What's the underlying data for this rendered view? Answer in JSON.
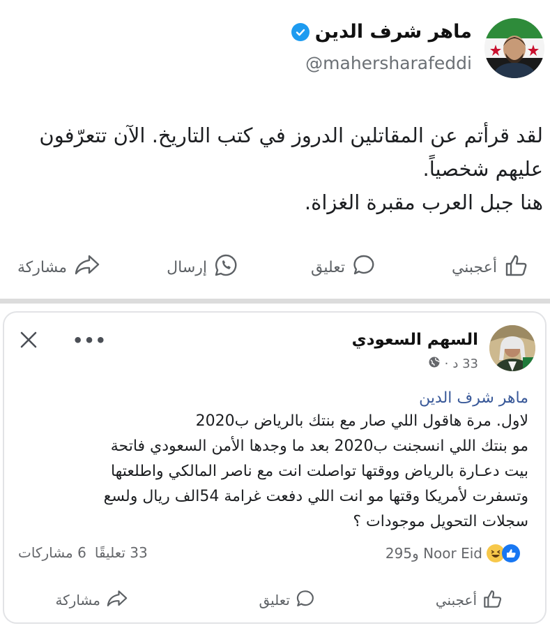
{
  "top_post": {
    "author_name": "ماهر شرف الدين",
    "handle": "@mahersharafeddi",
    "text_lines": [
      "لقد قرأتم عن المقاتلين الدروز في كتب التاريخ. الآن تتعرّفون",
      "عليهم شخصياً.",
      "هنا جبل العرب مقبرة الغزاة."
    ],
    "actions": {
      "like": "أعجبني",
      "comment": "تعليق",
      "send": "إرسال",
      "share": "مشاركة"
    }
  },
  "fb_post": {
    "author_name": "السهم السعودي",
    "time": "33 د",
    "mention": "ماهر شرف الدين",
    "text_lines": [
      "لاول. مرة هاقول اللي صار مع بنتك بالرياض ب2020",
      "مو  بنتك اللي انسجنت ب2020 بعد ما وجدها الأمن السعودي فاتحة",
      "بيت دعـارة بالرياض  ووقتها تواصلت انت مع ناصر المالكي واطلعتها",
      "وتسفرت لأمريكا وقتها مو انت اللي دفعت غرامة 54الف ريال ولسع",
      "سجلات التحويل موجودات  ؟"
    ],
    "reactions_text": "295و Noor Eid",
    "comments_count": "33 تعليقًا",
    "shares_count": "6 مشاركات",
    "actions": {
      "like": "أعجبني",
      "comment": "تعليق",
      "share": "مشاركة"
    },
    "more_label": "•••"
  },
  "colors": {
    "verified": "#1d9bf0",
    "like_blue": "#1877f2",
    "haha_yellow": "#f7c84a",
    "mention_blue": "#385898",
    "muted": "#65676b"
  }
}
